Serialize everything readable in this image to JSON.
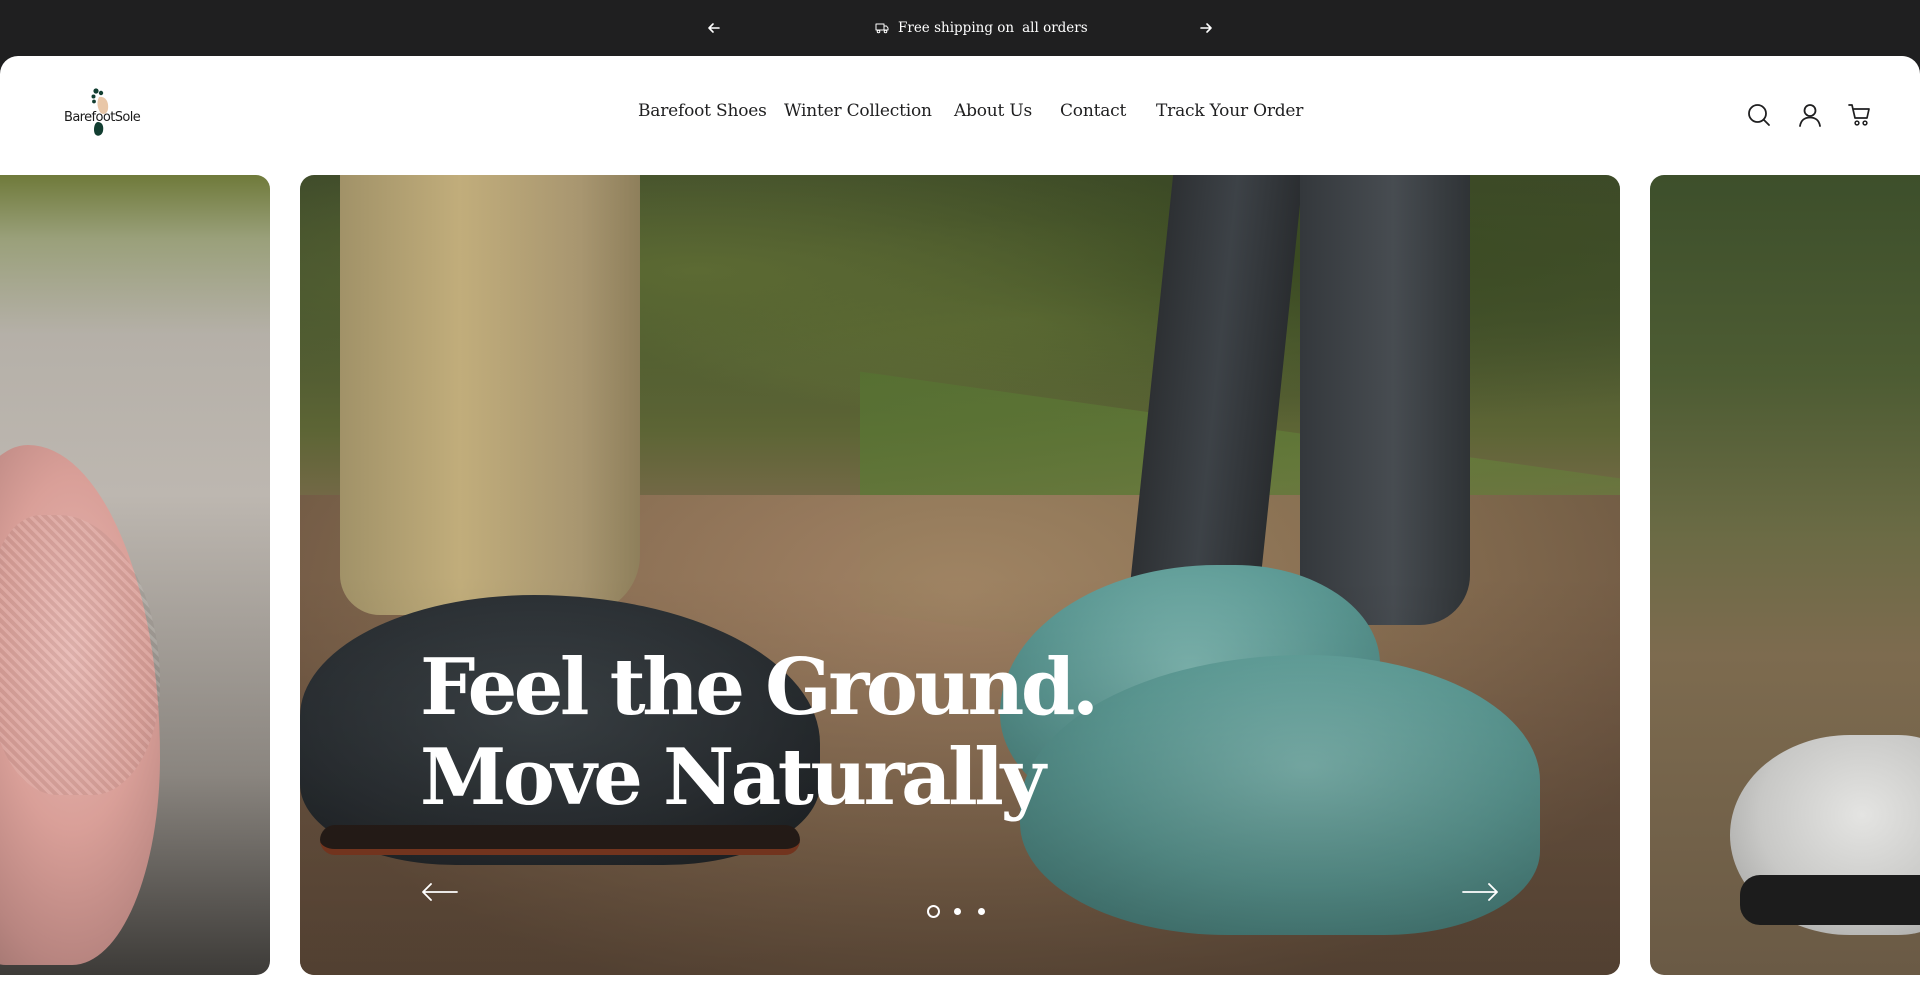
{
  "announcement": {
    "text_before": "Free shipping on",
    "link_text": "all orders"
  },
  "brand": {
    "name": "BarefootSole"
  },
  "nav": {
    "items": [
      "Barefoot Shoes",
      "Winter Collection",
      "About Us",
      "Contact",
      "Track Your Order"
    ]
  },
  "header_icons": [
    "search-icon",
    "account-icon",
    "cart-icon"
  ],
  "hero": {
    "title_line1": "Feel the Ground.",
    "title_line2": "Move Naturally",
    "slide_count": 3,
    "active_slide": 1
  },
  "colors": {
    "announcement_bg": "#1f1f20",
    "header_bg": "#ffffff",
    "text": "#1f1f20",
    "hero_text": "#ffffff"
  }
}
